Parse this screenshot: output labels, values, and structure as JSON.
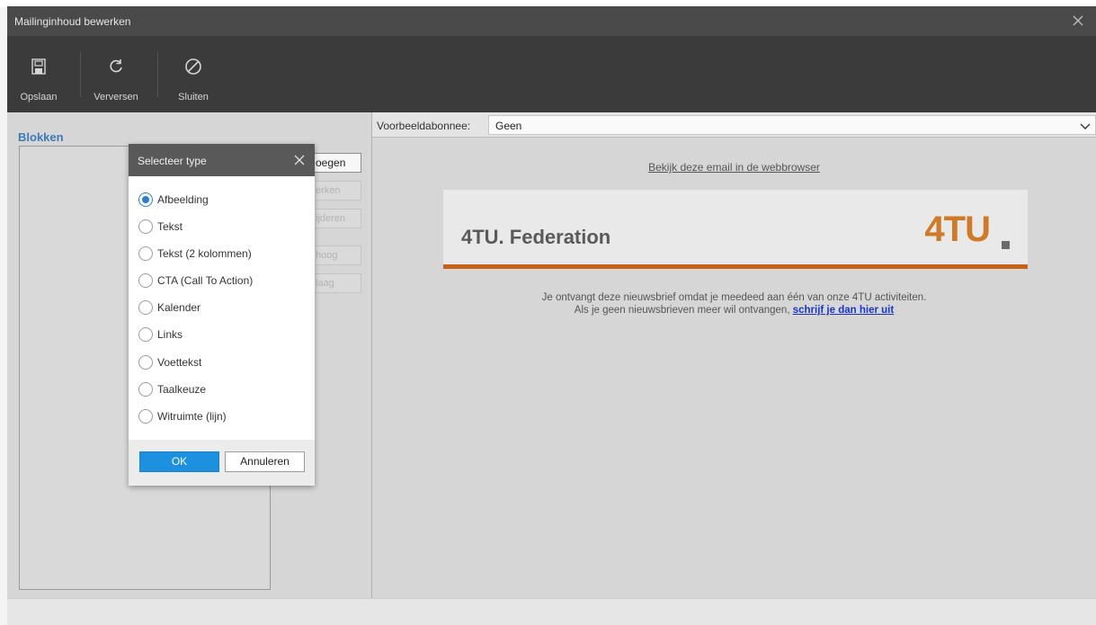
{
  "window": {
    "title": "Mailinginhoud bewerken"
  },
  "toolbar": {
    "buttons": [
      {
        "label": "Opslaan",
        "icon": "floppy-disk-icon"
      },
      {
        "label": "Verversen",
        "icon": "refresh-icon"
      },
      {
        "label": "Sluiten",
        "icon": "prohibit-icon"
      }
    ]
  },
  "left": {
    "heading": "Blokken",
    "buttons": [
      {
        "label": "Toevoegen",
        "visible": "oegen",
        "enabled": true
      },
      {
        "label": "Bewerken",
        "visible": "erken",
        "enabled": false
      },
      {
        "label": "Verwijderen",
        "visible": "ijderen",
        "enabled": false
      },
      {
        "label": "Omhoog",
        "visible": "hoog",
        "enabled": false
      },
      {
        "label": "Omlaag",
        "visible": "laag",
        "enabled": false
      }
    ]
  },
  "preview": {
    "subscriber_label": "Voorbeeldabonnee:",
    "subscriber_value": "Geen",
    "weblink": "Bekijk deze email in de webbrowser",
    "banner_title": "4TU. Federation",
    "logo_text": "4TU",
    "notice_line1": "Je ontvangt deze nieuwsbrief omdat je meedeed aan één van onze 4TU activiteiten.",
    "notice_line2_prefix": "Als je geen nieuwsbrieven meer wil ontvangen, ",
    "notice_link": "schrijf je dan hier uit"
  },
  "dialog": {
    "title": "Selecteer type",
    "options": [
      {
        "label": "Afbeelding",
        "checked": true
      },
      {
        "label": "Tekst",
        "checked": false
      },
      {
        "label": "Tekst (2 kolommen)",
        "checked": false
      },
      {
        "label": "CTA (Call To Action)",
        "checked": false
      },
      {
        "label": "Kalender",
        "checked": false
      },
      {
        "label": "Links",
        "checked": false
      },
      {
        "label": "Voettekst",
        "checked": false
      },
      {
        "label": "Taalkeuze",
        "checked": false
      },
      {
        "label": "Witruimte (lijn)",
        "checked": false
      }
    ],
    "ok": "OK",
    "cancel": "Annuleren"
  },
  "colors": {
    "accent": "#2b7fd0",
    "ok_button": "#1e90e0",
    "brand_orange": "#c4621c",
    "heading_blue": "#3d7ab8"
  }
}
